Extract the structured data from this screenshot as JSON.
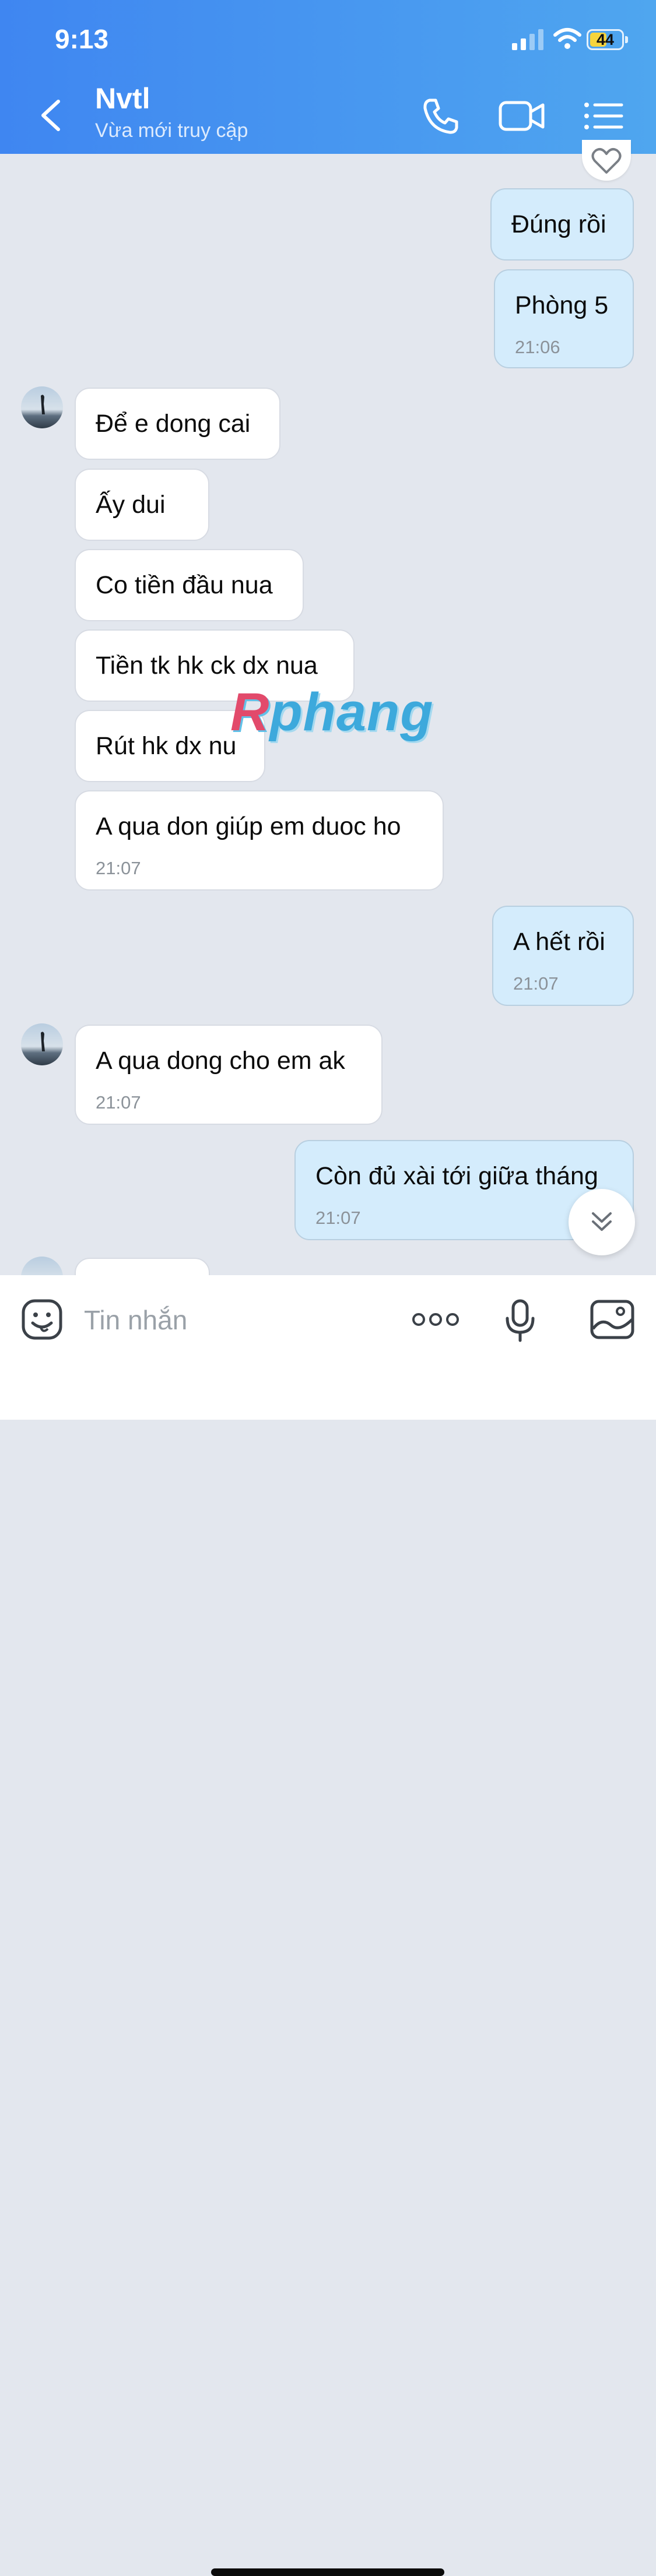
{
  "status_bar": {
    "time": "9:13",
    "battery": "44"
  },
  "header": {
    "contact_name": "Nvtl",
    "contact_status": "Vừa mới truy cập",
    "icons": [
      "back-arrow-icon",
      "phone-icon",
      "video-camera-icon",
      "menu-list-icon"
    ]
  },
  "messages": [
    {
      "side": "out",
      "text": "Đúng rồi"
    },
    {
      "side": "out",
      "text": "Phòng 5",
      "time": "21:06"
    },
    {
      "side": "in",
      "text": "Để e dong cai"
    },
    {
      "side": "in",
      "text": "Ấy dui"
    },
    {
      "side": "in",
      "text": "Co tiền đầu nua"
    },
    {
      "side": "in",
      "text": "Tiền tk hk ck dx nua"
    },
    {
      "side": "in",
      "text": "Rút hk dx nu"
    },
    {
      "side": "in",
      "text": "A qua don giúp em duoc ho",
      "time": "21:07"
    },
    {
      "side": "out",
      "text": "A hết rồi",
      "time": "21:07"
    },
    {
      "side": "in",
      "text": "A qua dong cho em ak",
      "time": "21:07"
    },
    {
      "side": "out",
      "text": "Còn đủ xài tới giữa tháng",
      "time": "21:07"
    }
  ],
  "watermark": {
    "first": "R",
    "rest": "phang"
  },
  "composer": {
    "placeholder": "Tin nhắn"
  },
  "colors": {
    "header_start": "#3f86f1",
    "header_end": "#4fa6ef",
    "outgoing_bubble": "#d4ecfc",
    "chat_bg": "#e3e7ee"
  }
}
